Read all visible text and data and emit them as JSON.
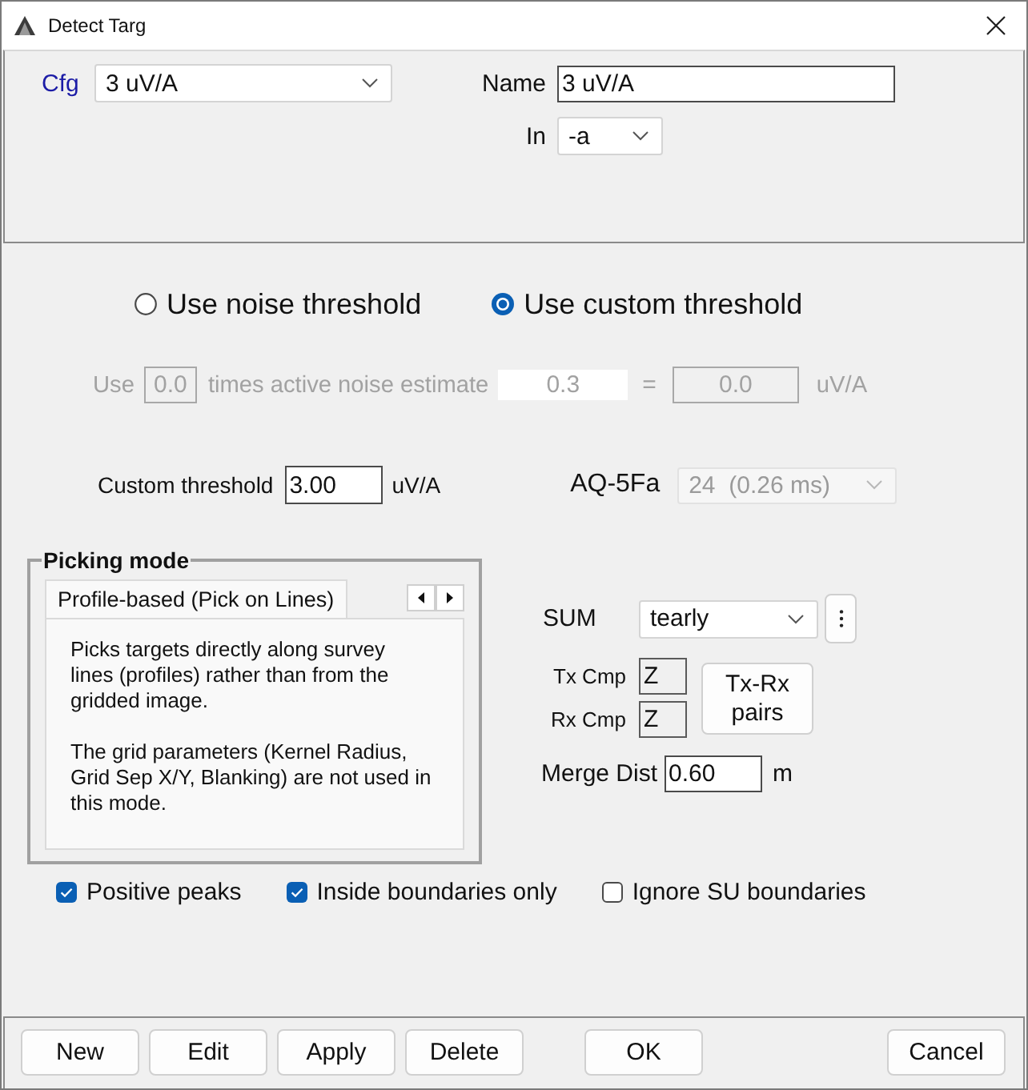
{
  "window": {
    "title": "Detect Targ"
  },
  "header": {
    "cfg_label": "Cfg",
    "cfg_value": "3 uV/A",
    "name_label": "Name",
    "name_value": "3 uV/A",
    "in_label": "In",
    "in_value": "-a"
  },
  "threshold_modes": [
    {
      "label": "Use noise threshold",
      "selected": false
    },
    {
      "label": "Use custom threshold",
      "selected": true
    }
  ],
  "noise_estimate": {
    "disabled": true,
    "prefix": "Use",
    "multiplier": "0.0",
    "text": "times active noise estimate",
    "estimate": "0.3",
    "equals": "=",
    "result": "0.0",
    "unit": "uV/A"
  },
  "custom_threshold": {
    "label": "Custom threshold",
    "value": "3.00",
    "unit": "uV/A"
  },
  "aq": {
    "label": "AQ-5Fa",
    "value": "24  (0.26 ms)",
    "disabled": true
  },
  "picking_mode": {
    "title": "Picking mode",
    "tabs": [
      {
        "label": "Profile-based (Pick on Lines)",
        "selected": true
      }
    ],
    "description": [
      "Picks targets directly along survey lines (profiles) rather than from the gridded image.",
      "The grid parameters (Kernel Radius, Grid Sep X/Y, Blanking) are not used in this mode."
    ]
  },
  "sum": {
    "label": "SUM",
    "value": "tearly"
  },
  "components": [
    {
      "label": "Tx Cmp",
      "value": "Z"
    },
    {
      "label": "Rx Cmp",
      "value": "Z"
    }
  ],
  "pairs_button": "Tx-Rx pairs",
  "merge_dist": {
    "label": "Merge Dist",
    "value": "0.60",
    "unit": "m"
  },
  "options": [
    {
      "label": "Positive peaks",
      "checked": true
    },
    {
      "label": "Inside boundaries only",
      "checked": true
    },
    {
      "label": "Ignore SU boundaries",
      "checked": false
    }
  ],
  "footer": {
    "edit_buttons": [
      "New",
      "Edit",
      "Apply",
      "Delete"
    ],
    "ok": "OK",
    "cancel": "Cancel"
  }
}
